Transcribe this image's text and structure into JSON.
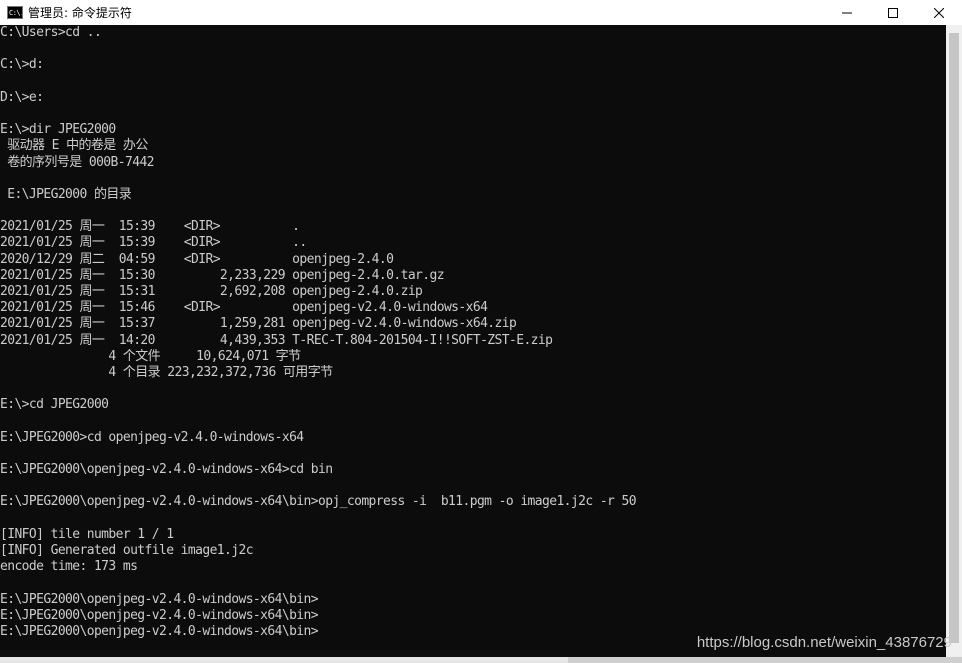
{
  "window": {
    "title": "管理员: 命令提示符",
    "app_icon_text": "C:\\."
  },
  "console": {
    "lines": [
      "C:\\Users>cd ..",
      "",
      "C:\\>d:",
      "",
      "D:\\>e:",
      "",
      "E:\\>dir JPEG2000",
      " 驱动器 E 中的卷是 办公",
      " 卷的序列号是 000B-7442",
      "",
      " E:\\JPEG2000 的目录",
      "",
      "2021/01/25 周一  15:39    <DIR>          .",
      "2021/01/25 周一  15:39    <DIR>          ..",
      "2020/12/29 周二  04:59    <DIR>          openjpeg-2.4.0",
      "2021/01/25 周一  15:30         2,233,229 openjpeg-2.4.0.tar.gz",
      "2021/01/25 周一  15:31         2,692,208 openjpeg-2.4.0.zip",
      "2021/01/25 周一  15:46    <DIR>          openjpeg-v2.4.0-windows-x64",
      "2021/01/25 周一  15:37         1,259,281 openjpeg-v2.4.0-windows-x64.zip",
      "2021/01/25 周一  14:20         4,439,353 T-REC-T.804-201504-I!!SOFT-ZST-E.zip",
      "               4 个文件     10,624,071 字节",
      "               4 个目录 223,232,372,736 可用字节",
      "",
      "E:\\>cd JPEG2000",
      "",
      "E:\\JPEG2000>cd openjpeg-v2.4.0-windows-x64",
      "",
      "E:\\JPEG2000\\openjpeg-v2.4.0-windows-x64>cd bin",
      "",
      "E:\\JPEG2000\\openjpeg-v2.4.0-windows-x64\\bin>opj_compress -i  b11.pgm -o image1.j2c -r 50",
      "",
      "[INFO] tile number 1 / 1",
      "[INFO] Generated outfile image1.j2c",
      "encode time: 173 ms",
      "",
      "E:\\JPEG2000\\openjpeg-v2.4.0-windows-x64\\bin>",
      "E:\\JPEG2000\\openjpeg-v2.4.0-windows-x64\\bin>",
      "E:\\JPEG2000\\openjpeg-v2.4.0-windows-x64\\bin>"
    ]
  },
  "watermark": "https://blog.csdn.net/weixin_43876729",
  "colors": {
    "console_bg": "#0c0c0c",
    "console_text": "#cccccc",
    "titlebar_bg": "#ffffff"
  }
}
